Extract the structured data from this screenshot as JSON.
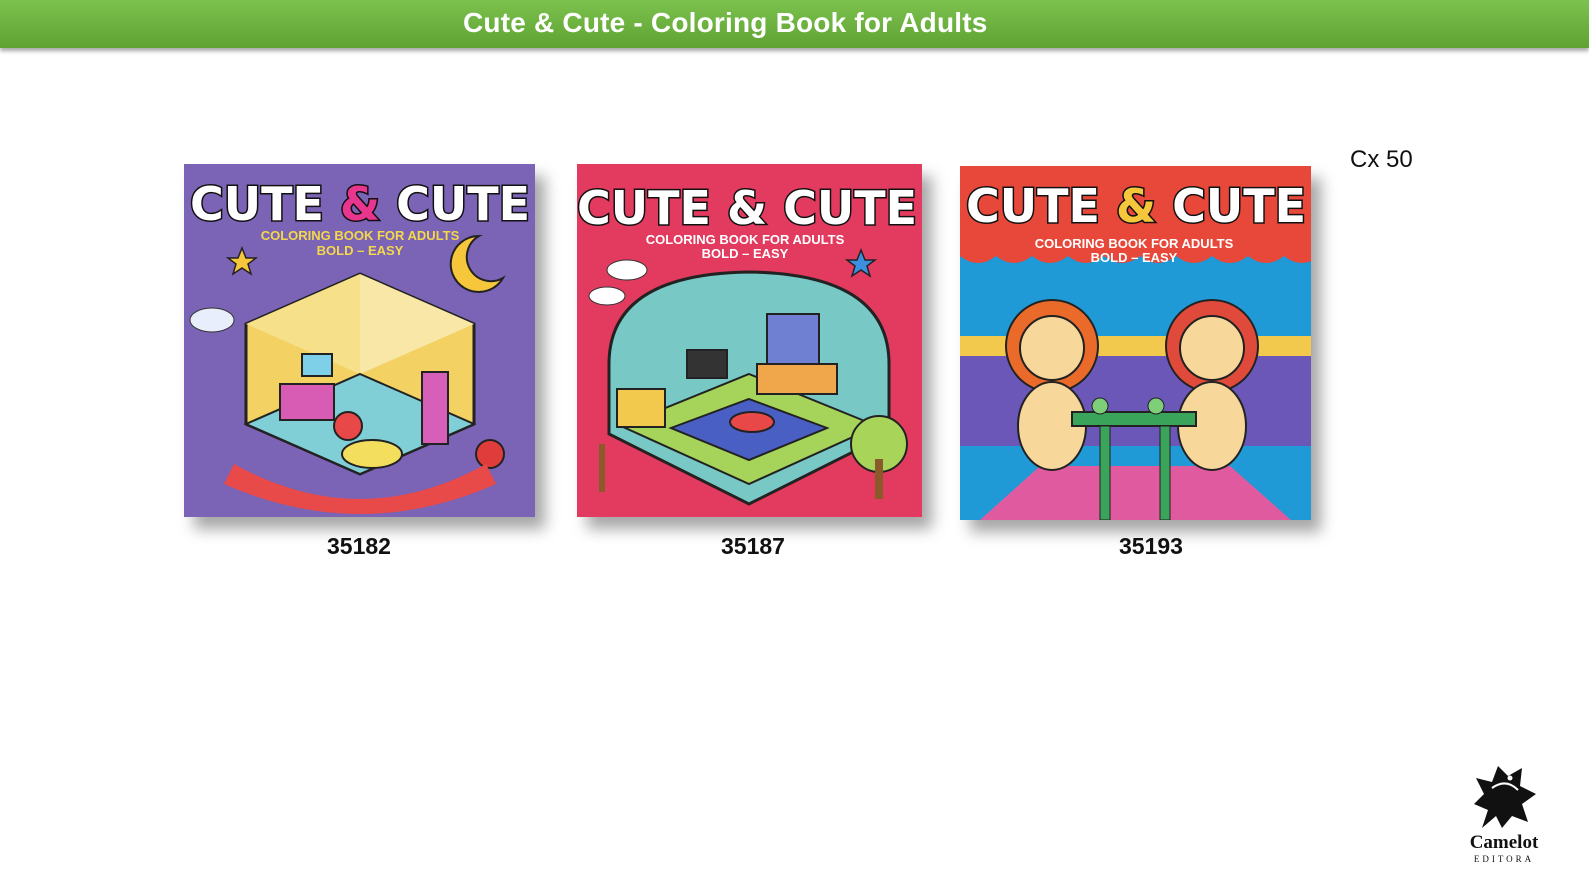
{
  "header": {
    "title": "Cute & Cute - Coloring Book for Adults"
  },
  "box_quantity": "Cx 50",
  "cover_text": {
    "title_left": "CUTE",
    "ampersand": "&",
    "title_right": "CUTE",
    "subtitle_line1": "COLORING BOOK FOR ADULTS",
    "subtitle_line2": "BOLD – EASY"
  },
  "products": [
    {
      "code": "35182",
      "cover_color": "#7b63b5",
      "theme": "bedroom-office"
    },
    {
      "code": "35187",
      "cover_color": "#e23b5f",
      "theme": "living-room"
    },
    {
      "code": "35193",
      "cover_color": "#e8483a",
      "theme": "lions-tea-party"
    }
  ],
  "brand": {
    "name": "Camelot",
    "subtitle": "EDITORA"
  }
}
